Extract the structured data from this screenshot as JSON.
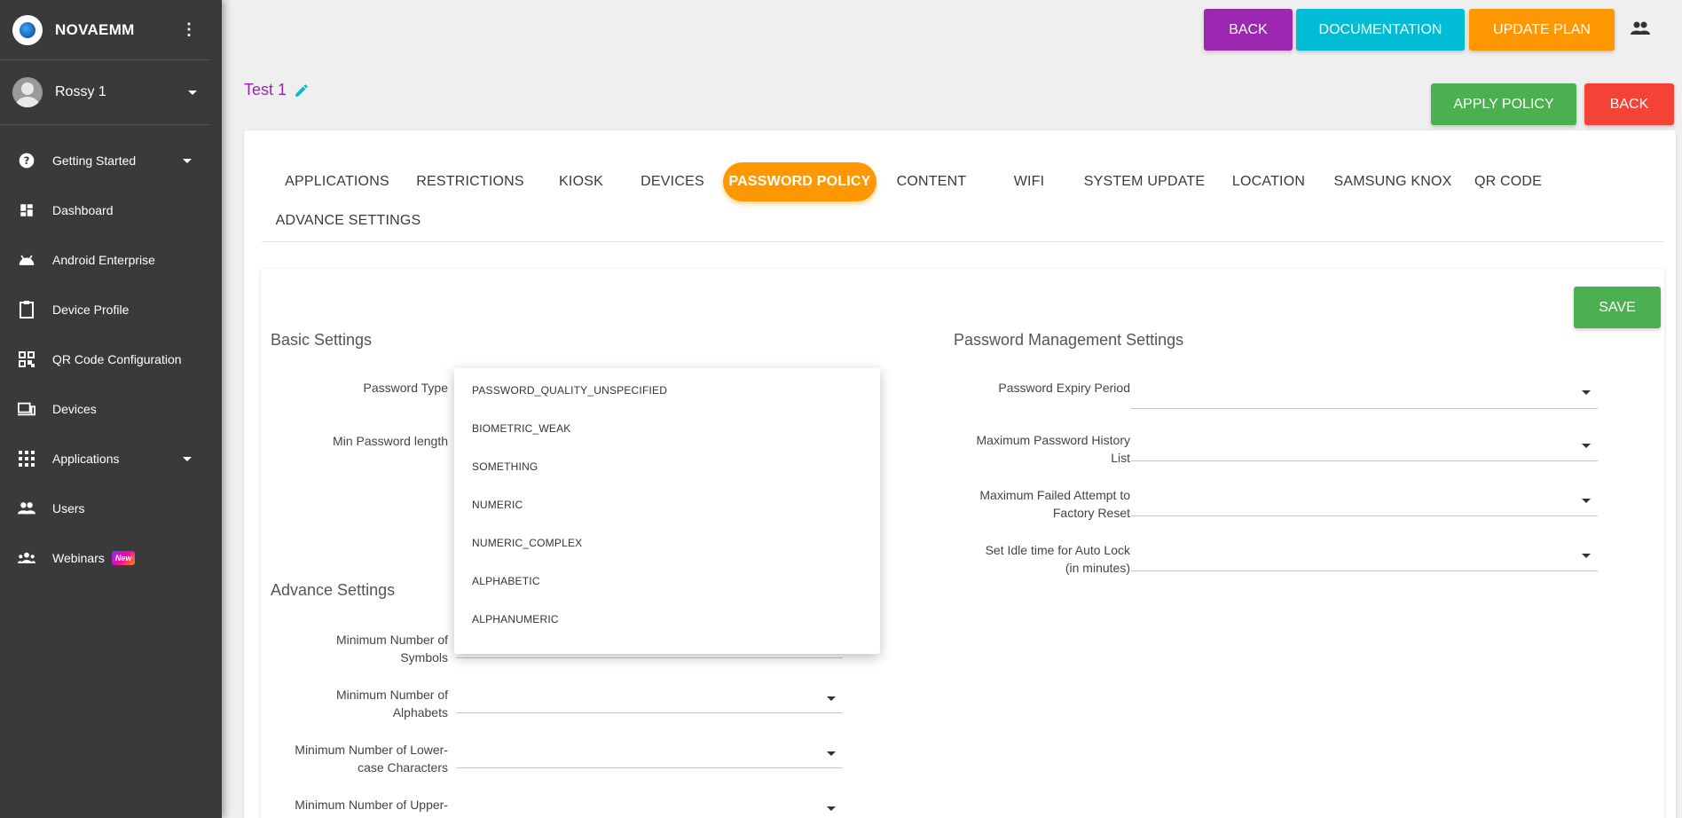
{
  "sidebar": {
    "brand": "NOVAEMM",
    "user": "Rossy 1",
    "items": [
      {
        "label": "Getting Started",
        "icon": "help-circle-icon",
        "expandable": true
      },
      {
        "label": "Dashboard",
        "icon": "dashboard-icon",
        "expandable": false
      },
      {
        "label": "Android Enterprise",
        "icon": "android-icon",
        "expandable": false
      },
      {
        "label": "Device Profile",
        "icon": "clipboard-icon",
        "expandable": false
      },
      {
        "label": "QR Code Configuration",
        "icon": "qr-code-icon",
        "expandable": false
      },
      {
        "label": "Devices",
        "icon": "devices-icon",
        "expandable": false
      },
      {
        "label": "Applications",
        "icon": "apps-grid-icon",
        "expandable": true
      },
      {
        "label": "Users",
        "icon": "users-icon",
        "expandable": false
      },
      {
        "label": "Webinars",
        "icon": "groups-icon",
        "expandable": false,
        "badge": "New"
      }
    ]
  },
  "topbar": {
    "back": "BACK",
    "documentation": "DOCUMENTATION",
    "update_plan": "UPDATE PLAN",
    "colors": {
      "back": "#9c27b0",
      "documentation": "#00bcd4",
      "update_plan": "#ff9800"
    }
  },
  "policy": {
    "name": "Test 1",
    "apply": "APPLY POLICY",
    "back": "BACK"
  },
  "tabs": [
    "APPLICATIONS",
    "RESTRICTIONS",
    "KIOSK",
    "DEVICES",
    "PASSWORD POLICY",
    "CONTENT",
    "WIFI",
    "SYSTEM UPDATE",
    "LOCATION",
    "SAMSUNG KNOX",
    "QR CODE",
    "ADVANCE SETTINGS"
  ],
  "active_tab": "PASSWORD POLICY",
  "save": "SAVE",
  "basic": {
    "title": "Basic Settings",
    "password_type": "Password Type",
    "min_length": "Min Password length"
  },
  "advance": {
    "title": "Advance Settings",
    "symbols": [
      "Minimum Number of",
      "Symbols"
    ],
    "alphabets": [
      "Minimum Number of",
      "Alphabets"
    ],
    "lower": [
      "Minimum Number of Lower-",
      "case Characters"
    ],
    "upper": [
      "Minimum Number of Upper-"
    ]
  },
  "management": {
    "title": "Password Management Settings",
    "expiry": "Password Expiry Period",
    "history": [
      "Maximum Password History",
      "List"
    ],
    "failed": [
      "Maximum Failed Attempt to",
      "Factory Reset"
    ],
    "idle": [
      "Set Idle time for Auto Lock",
      "(in minutes)"
    ]
  },
  "dropdown_options": [
    "PASSWORD_QUALITY_UNSPECIFIED",
    "BIOMETRIC_WEAK",
    "SOMETHING",
    "NUMERIC",
    "NUMERIC_COMPLEX",
    "ALPHABETIC",
    "ALPHANUMERIC"
  ]
}
